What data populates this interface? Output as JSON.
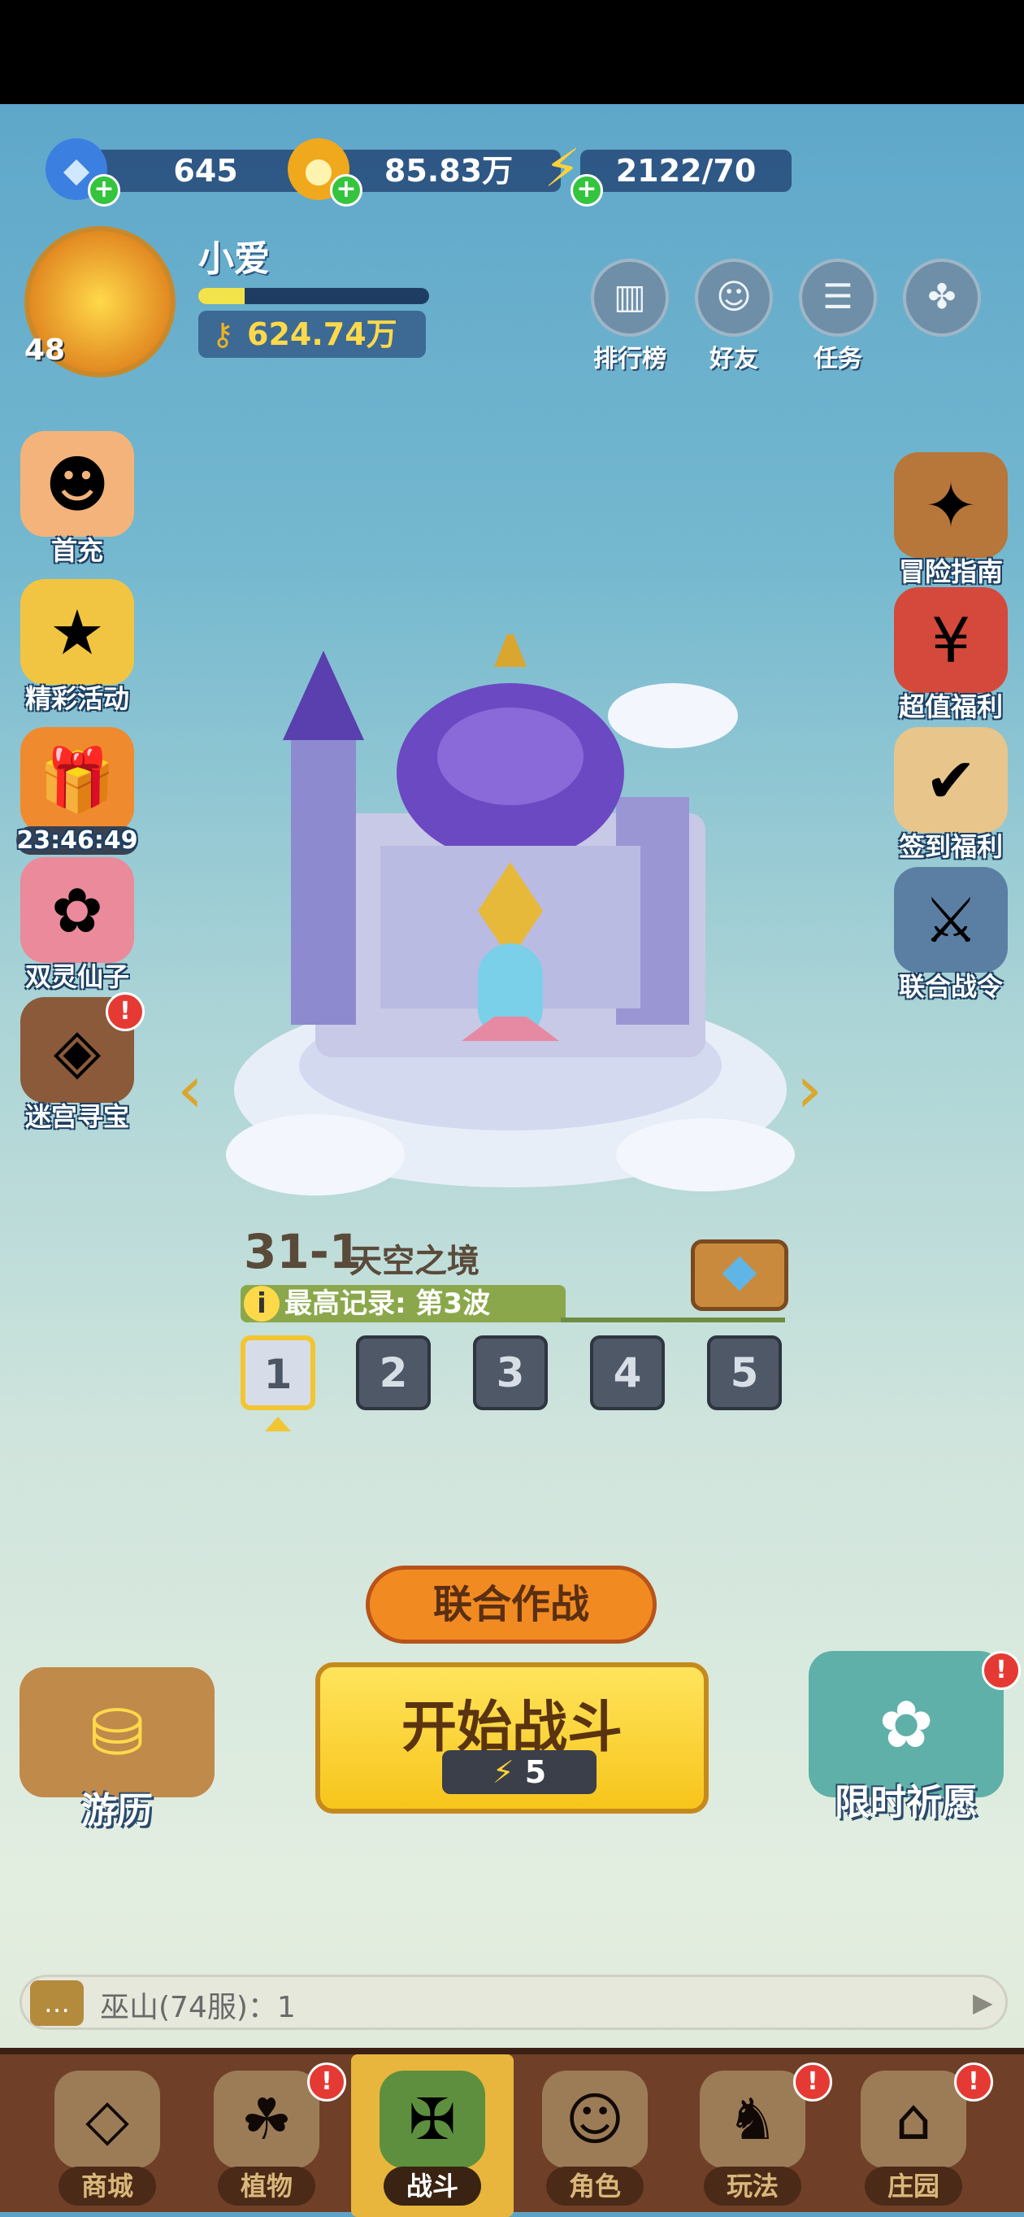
{
  "currencies": {
    "diamond": {
      "icon": "diamond-icon",
      "value": "645"
    },
    "coin": {
      "icon": "coin-icon",
      "value": "85.83万"
    },
    "energy": {
      "icon": "lightning-icon",
      "value": "2122/70"
    }
  },
  "player": {
    "name": "小爱",
    "level": "48",
    "xp_progress": 0.2,
    "keys": "624.74万"
  },
  "top_buttons": [
    {
      "icon": "leaderboard-icon",
      "label": "排行榜"
    },
    {
      "icon": "friends-icon",
      "label": "好友"
    },
    {
      "icon": "tasks-icon",
      "label": "任务"
    },
    {
      "icon": "gamepad-icon",
      "label": ""
    }
  ],
  "left_menu": [
    {
      "icon": "first-recharge-icon",
      "label": "首充"
    },
    {
      "icon": "events-icon",
      "label": "精彩活动"
    },
    {
      "icon": "gift-timer-icon",
      "label": "23:46:49"
    },
    {
      "icon": "twin-fairy-icon",
      "label": "双灵仙子"
    },
    {
      "icon": "maze-treasure-icon",
      "label": "迷宫寻宝",
      "badge": "!"
    }
  ],
  "right_menu": [
    {
      "icon": "adventure-guide-icon",
      "label": "冒险指南"
    },
    {
      "icon": "value-welfare-icon",
      "label": "超值福利"
    },
    {
      "icon": "signin-welfare-icon",
      "label": "签到福利"
    },
    {
      "icon": "battle-pass-icon",
      "label": "联合战令"
    }
  ],
  "stage": {
    "number": "31-1",
    "name": "天空之境",
    "record": "最高记录: 第3波",
    "waves": [
      "1",
      "2",
      "3",
      "4",
      "5"
    ],
    "selected_wave": "1"
  },
  "actions": {
    "coop": "联合作战",
    "start": "开始战斗",
    "energy_cost": "5",
    "travel": "游历",
    "wish": "限时祈愿",
    "wish_badge": "!"
  },
  "chat": {
    "text": "巫山(74服)：1"
  },
  "nav": [
    {
      "icon": "shop-icon",
      "label": "商城"
    },
    {
      "icon": "plants-icon",
      "label": "植物",
      "badge": "!"
    },
    {
      "icon": "battle-icon",
      "label": "战斗",
      "active": true
    },
    {
      "icon": "character-icon",
      "label": "角色"
    },
    {
      "icon": "gameplay-icon",
      "label": "玩法",
      "badge": "!"
    },
    {
      "icon": "manor-icon",
      "label": "庄园",
      "badge": "!"
    }
  ]
}
